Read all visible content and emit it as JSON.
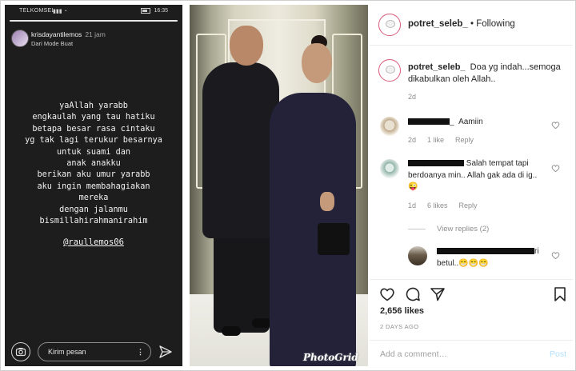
{
  "story": {
    "status": {
      "carrier": "TELKOMSEL",
      "time": "16:35"
    },
    "progress": 1.0,
    "username": "krisdayantilemos",
    "time_ago": "21 jam",
    "subtitle": "Dari Mode Buat",
    "lines": [
      "yaAllah yarabb",
      "engkaulah yang tau hatiku",
      "betapa besar rasa cintaku",
      "yg tak lagi terukur besarnya",
      "untuk suami dan",
      "anak anakku",
      "berikan aku umur yarabb",
      "aku ingin membahagiakan",
      "mereka",
      "dengan jalanmu",
      "bismillahirahmanirahim"
    ],
    "mention": "@raullemos06",
    "message_placeholder": "Kirim pesan",
    "icons": {
      "camera": "camera-icon",
      "more": "more-dots-icon",
      "send": "send-icon"
    }
  },
  "photo": {
    "watermark": "PhotoGrid"
  },
  "post": {
    "header": {
      "username": "potret_seleb_",
      "separator": " • ",
      "follow_state": "Following"
    },
    "caption": {
      "username": "potret_seleb_",
      "text": "Doa yg indah...semoga dikabulkan oleh Allah..",
      "age": "2d"
    },
    "comments": [
      {
        "user_suffix": "_",
        "text": "Aamiin",
        "age": "2d",
        "likes": "1 like",
        "reply": "Reply"
      },
      {
        "user_suffix": "",
        "text": "Salah tempat tapi berdoanya min.. Allah gak ada di ig..😜",
        "age": "1d",
        "likes": "6 likes",
        "reply": "Reply"
      }
    ],
    "view_replies": "View replies (2)",
    "reply": {
      "user_suffix": "ri",
      "text": "betul..😁😁😁"
    },
    "likes": "2,656 likes",
    "date": "2 DAYS AGO",
    "add_comment_placeholder": "Add a comment…",
    "post_label": "Post"
  },
  "colors": {
    "story_bg": "#1d1d1d",
    "avatar_ring": "#d95a7a",
    "meta_gray": "#8e8e8e",
    "post_button": "#b2dffc"
  }
}
